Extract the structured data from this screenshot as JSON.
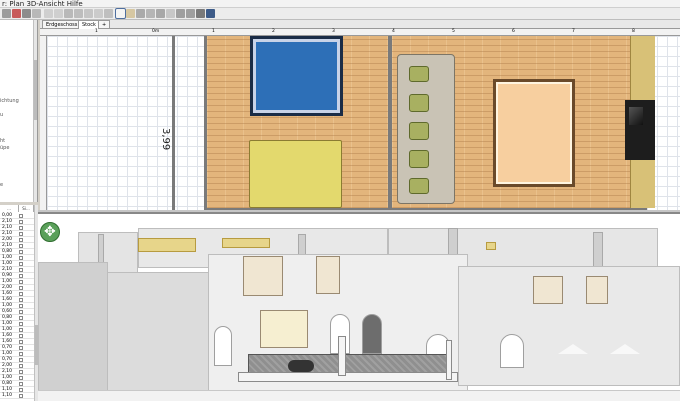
{
  "window": {
    "title": "r: Plan  3D-Ansicht  Hilfe"
  },
  "plan": {
    "tabs": [
      {
        "label": "Erdgeschoss"
      },
      {
        "label": "Stock 1"
      },
      {
        "label": "+"
      }
    ],
    "ruler_labels": [
      "1",
      "0m",
      "1",
      "2",
      "3",
      "4",
      "5",
      "6",
      "7",
      "8"
    ],
    "dimension": "3,99"
  },
  "sidebar": {
    "tree_items": [
      "ichtung",
      "u",
      "ht",
      "üpe",
      "e"
    ]
  },
  "furniture_table": {
    "columns": [
      "...",
      "Si..."
    ],
    "rows": [
      "0,00",
      "2,10",
      "2,10",
      "2,10",
      "2,00",
      "2,10",
      "0,80",
      "1,00",
      "1,00",
      "2,10",
      "0,90",
      "1,00",
      "2,00",
      "1,60",
      "1,60",
      "1,00",
      "0,60",
      "0,80",
      "1,00",
      "1,00",
      "1,60",
      "1,60",
      "0,70",
      "1,00",
      "0,70",
      "2,00",
      "2,10",
      "1,00",
      "0,80",
      "1,10",
      "1,10"
    ]
  },
  "colors": {
    "floor": "#e3b57c",
    "rug_blue": "#2d6fb7",
    "bed": "#e3d96d",
    "sofa": "#c9c3b5",
    "accent": "#4f6f9f"
  }
}
